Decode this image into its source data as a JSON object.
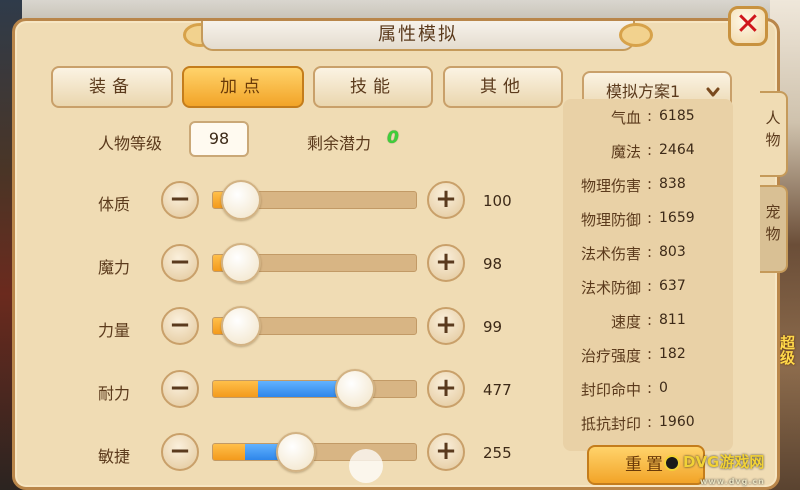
{
  "window": {
    "title": "属性模拟",
    "close_symbol": "✕"
  },
  "tabs": [
    {
      "label": "装备",
      "active": false
    },
    {
      "label": "加点",
      "active": true
    },
    {
      "label": "技能",
      "active": false
    },
    {
      "label": "其他",
      "active": false
    }
  ],
  "plan_select": {
    "value": "模拟方案1"
  },
  "level": {
    "label": "人物等级",
    "value": "98"
  },
  "potential": {
    "label": "剩余潜力",
    "value": "0"
  },
  "stats": [
    {
      "label": "体质",
      "value": "100",
      "base_fraction": 0.14,
      "added_fraction": 0.0
    },
    {
      "label": "魔力",
      "value": "98",
      "base_fraction": 0.14,
      "added_fraction": 0.0
    },
    {
      "label": "力量",
      "value": "99",
      "base_fraction": 0.14,
      "added_fraction": 0.0
    },
    {
      "label": "耐力",
      "value": "477",
      "base_fraction": 0.22,
      "added_fraction": 0.48
    },
    {
      "label": "敏捷",
      "value": "255",
      "base_fraction": 0.16,
      "added_fraction": 0.25
    }
  ],
  "attributes": [
    {
      "name": "气血",
      "value": "6185"
    },
    {
      "name": "魔法",
      "value": "2464"
    },
    {
      "name": "物理伤害",
      "value": "838"
    },
    {
      "name": "物理防御",
      "value": "1659"
    },
    {
      "name": "法术伤害",
      "value": "803"
    },
    {
      "name": "法术防御",
      "value": "637"
    },
    {
      "name": "速度",
      "value": "811"
    },
    {
      "name": "治疗强度",
      "value": "182"
    },
    {
      "name": "封印命中",
      "value": "0"
    },
    {
      "name": "抵抗封印",
      "value": "1960"
    }
  ],
  "reset_button": {
    "label": "重置"
  },
  "side_tabs": [
    {
      "label": "人物",
      "active": true
    },
    {
      "label": "宠物",
      "active": false
    }
  ],
  "background_text": "超级",
  "watermark": {
    "text": "DVG游戏网",
    "sub": "www.dvg.cn"
  },
  "colors": {
    "panel": "#f0dcb4",
    "active_tab": "#f2a428",
    "base_fill": "#f39a1c",
    "added_fill": "#2e86ea",
    "potential": "#3fcf3a",
    "close_x": "#d0161b"
  }
}
